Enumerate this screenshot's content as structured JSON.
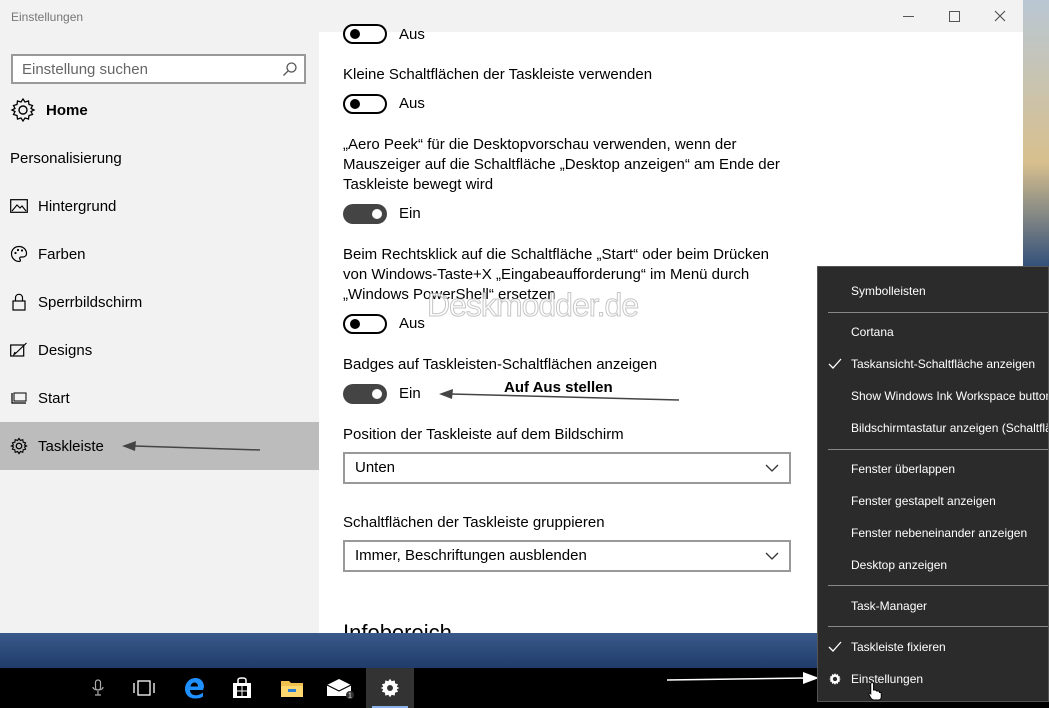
{
  "window": {
    "title": "Einstellungen",
    "minimize_glyph": "—",
    "close_glyph": "✕"
  },
  "sidebar": {
    "search_placeholder": "Einstellung suchen",
    "home_label": "Home",
    "section_title": "Personalisierung",
    "items": [
      {
        "label": "Hintergrund",
        "icon": "picture-icon"
      },
      {
        "label": "Farben",
        "icon": "palette-icon"
      },
      {
        "label": "Sperrbildschirm",
        "icon": "lock-icon"
      },
      {
        "label": "Designs",
        "icon": "brush-icon"
      },
      {
        "label": "Start",
        "icon": "start-icon"
      },
      {
        "label": "Taskleiste",
        "icon": "gear-icon",
        "active": true
      }
    ]
  },
  "main": {
    "toggle_top_state": "Aus",
    "settings": [
      {
        "label": "Kleine Schaltflächen der Taskleiste verwenden",
        "state": "Aus"
      },
      {
        "label": "„Aero Peek“ für die Desktopvorschau verwenden, wenn der Mauszeiger auf die Schaltfläche „Desktop anzeigen“ am Ende der Taskleiste bewegt wird",
        "state": "Ein"
      },
      {
        "label": "Beim Rechtsklick auf die Schaltfläche „Start“ oder beim Drücken von Windows-Taste+X „Eingabeaufforderung“ im Menü durch „Windows PowerShell“ ersetzen",
        "state": "Aus"
      },
      {
        "label": "Badges auf Taskleisten-Schaltflächen anzeigen",
        "state": "Ein"
      }
    ],
    "position_label": "Position der Taskleiste auf dem Bildschirm",
    "position_value": "Unten",
    "group_label": "Schaltflächen der Taskleiste gruppieren",
    "group_value": "Immer, Beschriftungen ausblenden",
    "next_section": "Infobereich"
  },
  "watermark": "Deskmodder.de",
  "annotation": "Auf Aus stellen",
  "context_menu": {
    "items": [
      {
        "label": "Symbolleisten",
        "check": false
      },
      {
        "label": "Cortana",
        "check": false
      },
      {
        "label": "Taskansicht-Schaltfläche anzeigen",
        "check": true
      },
      {
        "label": "Show Windows Ink Workspace button",
        "check": false
      },
      {
        "label": "Bildschirmtastatur anzeigen (Schaltfläche)",
        "check": false
      },
      {
        "label": "Fenster überlappen",
        "check": false
      },
      {
        "label": "Fenster gestapelt anzeigen",
        "check": false
      },
      {
        "label": "Fenster nebeneinander anzeigen",
        "check": false
      },
      {
        "label": "Desktop anzeigen",
        "check": false
      },
      {
        "label": "Task-Manager",
        "check": false
      },
      {
        "label": "Taskleiste fixieren",
        "check": true
      },
      {
        "label": "Einstellungen",
        "check": false
      }
    ]
  },
  "taskbar": {
    "icons": [
      "microphone-icon",
      "task-view-icon",
      "edge-icon",
      "store-icon",
      "explorer-icon",
      "mail-icon",
      "settings-icon"
    ],
    "mail_badge": "1"
  },
  "colors": {
    "accent": "#0078d7",
    "toggle_on": "#444444",
    "menu_bg": "#2b2b2b"
  }
}
